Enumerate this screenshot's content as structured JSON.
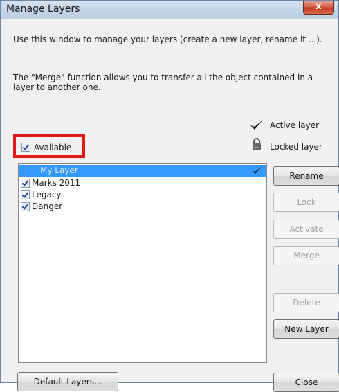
{
  "window": {
    "title": "Manage Layers",
    "close_glyph": "x"
  },
  "info": {
    "line1": "Use this window to manage your layers (create a new layer, rename it ...).",
    "line2": "The \"Merge\" function allows you to transfer all the object contained in a layer to another one."
  },
  "legend": {
    "active_label": "Active layer",
    "locked_label": "Locked layer",
    "active_icon": "checkmark-icon",
    "locked_icon": "lock-icon"
  },
  "filter": {
    "label": "Available",
    "checked": true
  },
  "layers": [
    {
      "name": "My Layer",
      "checked": true,
      "selected": true,
      "active": true
    },
    {
      "name": "Marks 2011",
      "checked": true,
      "selected": false,
      "active": false
    },
    {
      "name": "Legacy",
      "checked": true,
      "selected": false,
      "active": false
    },
    {
      "name": "Danger",
      "checked": true,
      "selected": false,
      "active": false
    }
  ],
  "buttons": {
    "rename": "Rename",
    "lock": "Lock",
    "activate": "Activate",
    "merge": "Merge",
    "delete": "Delete",
    "new_layer": "New Layer",
    "default_layers": "Default Layers...",
    "close": "Close"
  },
  "colors": {
    "selection": "#3399ff",
    "highlight_border": "#e01818",
    "title_bar": "#c4d4e8",
    "close_button": "#c33a20"
  }
}
